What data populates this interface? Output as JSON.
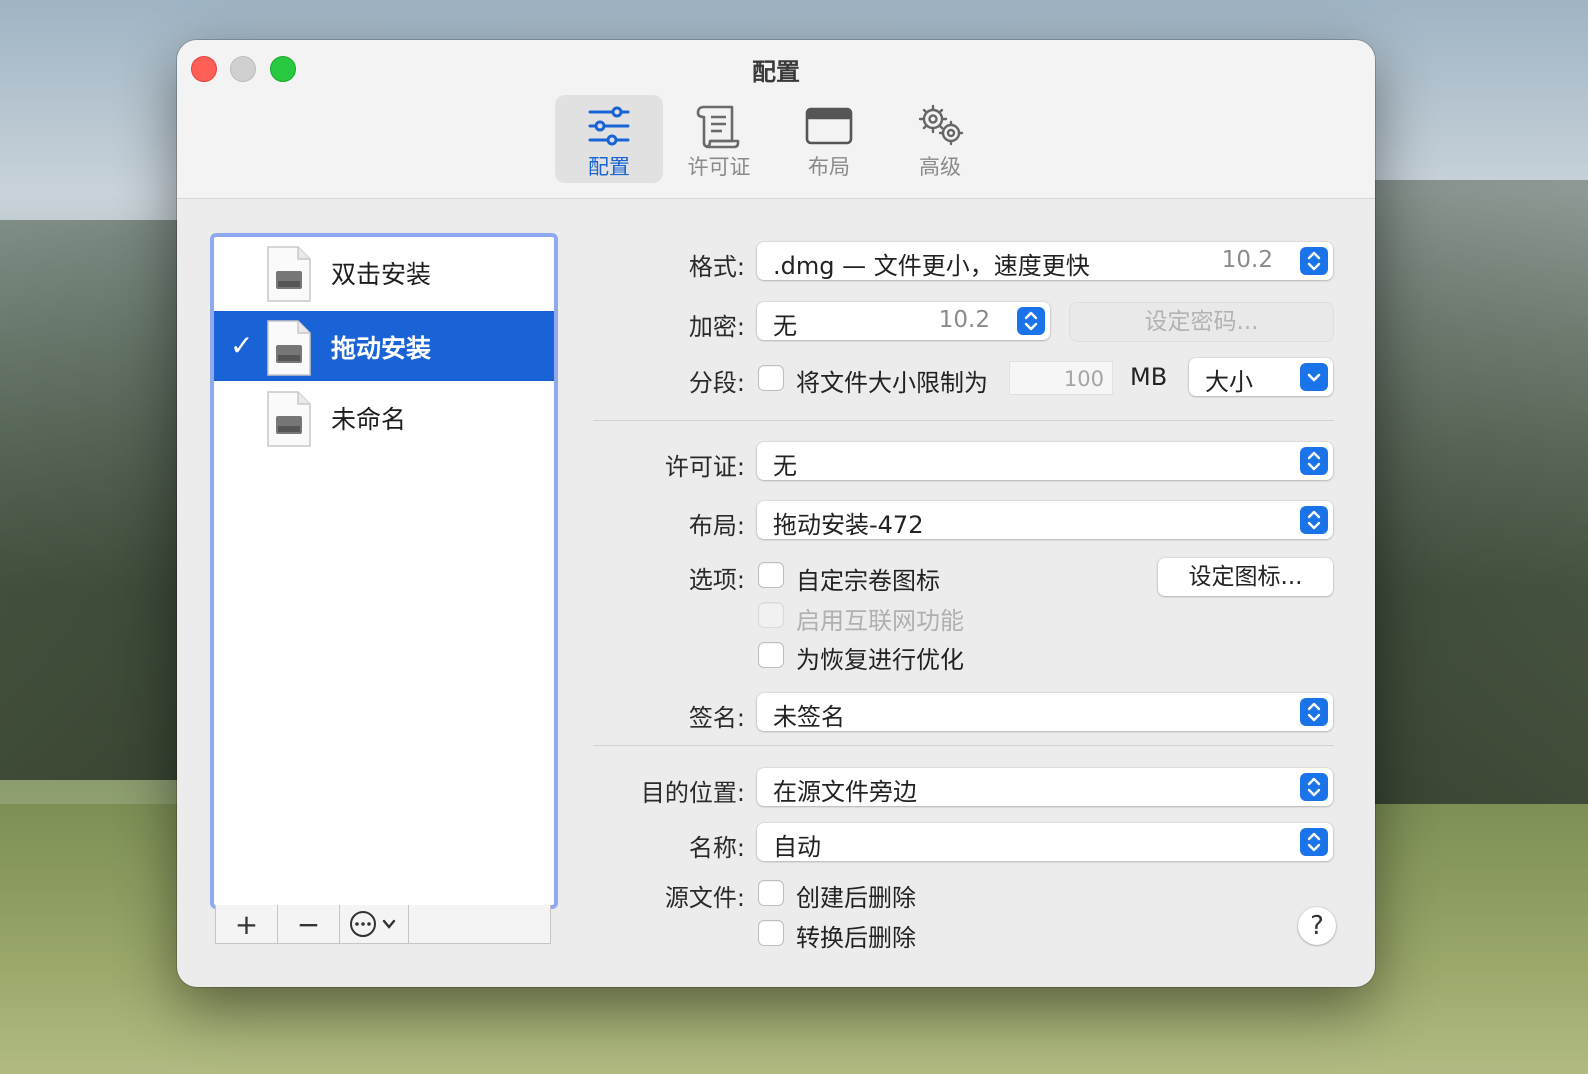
{
  "window": {
    "title": "配置"
  },
  "toolbar": [
    {
      "label": "配置",
      "icon": "sliders-icon",
      "active": true
    },
    {
      "label": "许可证",
      "icon": "scroll-license-icon",
      "active": false
    },
    {
      "label": "布局",
      "icon": "window-layout-icon",
      "active": false
    },
    {
      "label": "高级",
      "icon": "gears-icon",
      "active": false
    }
  ],
  "sidebar": {
    "items": [
      {
        "label": "双击安装",
        "selected": false
      },
      {
        "label": "拖动安装",
        "selected": true,
        "check": "✓"
      },
      {
        "label": "未命名",
        "selected": false
      }
    ],
    "buttons": {
      "add": "+",
      "remove": "−",
      "more": "⋯"
    }
  },
  "form": {
    "format": {
      "label": "格式:",
      "value": ".dmg — 文件更小，速度更快",
      "version": "10.2"
    },
    "encryption": {
      "label": "加密:",
      "value": "无",
      "version": "10.2",
      "set_password": "设定密码..."
    },
    "segment": {
      "label": "分段:",
      "checkbox_label": "将文件大小限制为",
      "size_value": "100",
      "unit": "MB",
      "size_popup": "大小"
    },
    "license": {
      "label": "许可证:",
      "value": "无"
    },
    "layout": {
      "label": "布局:",
      "value": "拖动安装-472"
    },
    "options": {
      "label": "选项:",
      "custom_icon": "自定宗卷图标",
      "set_icon_button": "设定图标...",
      "internet_enable": "启用互联网功能",
      "optimize_restore": "为恢复进行优化"
    },
    "signature": {
      "label": "签名:",
      "value": "未签名"
    },
    "destination": {
      "label": "目的位置:",
      "value": "在源文件旁边"
    },
    "name": {
      "label": "名称:",
      "value": "自动"
    },
    "source": {
      "label": "源文件:",
      "delete_after_create": "创建后删除",
      "delete_after_convert": "转换后删除"
    },
    "help": "?"
  },
  "colors": {
    "accent": "#1a63d6",
    "selection_border": "#8ea9ef",
    "close": "#ff5f57",
    "maximize": "#28c840"
  }
}
